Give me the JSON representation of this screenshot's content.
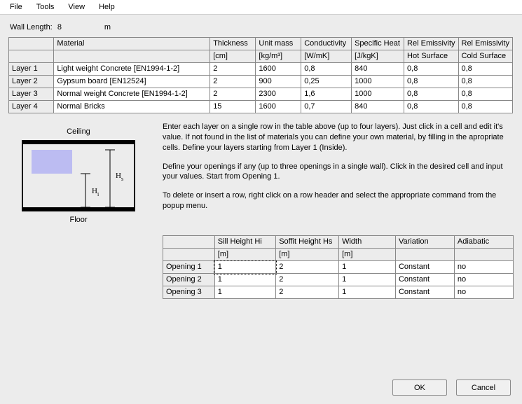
{
  "menu": {
    "items": [
      "File",
      "Tools",
      "View",
      "Help"
    ]
  },
  "wall_length": {
    "label": "Wall Length:",
    "value": "8",
    "unit": "m"
  },
  "layers_table": {
    "headers1": [
      "",
      "Material",
      "Thickness",
      "Unit mass",
      "Conductivity",
      "Specific Heat",
      "Rel Emissivity",
      "Rel Emissivity"
    ],
    "headers2": [
      "",
      "",
      "[cm]",
      "[kg/m³]",
      "[W/mK]",
      "[J/kgK]",
      "Hot Surface",
      "Cold Surface"
    ],
    "rows": [
      {
        "name": "Layer 1",
        "material": "Light weight Concrete [EN1994-1-2]",
        "thickness": "2",
        "unitmass": "1600",
        "conductivity": "0,8",
        "specheat": "840",
        "emis_hot": "0,8",
        "emis_cold": "0,8"
      },
      {
        "name": "Layer 2",
        "material": "Gypsum board [EN12524]",
        "thickness": "2",
        "unitmass": "900",
        "conductivity": "0,25",
        "specheat": "1000",
        "emis_hot": "0,8",
        "emis_cold": "0,8"
      },
      {
        "name": "Layer 3",
        "material": "Normal weight Concrete [EN1994-1-2]",
        "thickness": "2",
        "unitmass": "2300",
        "conductivity": "1,6",
        "specheat": "1000",
        "emis_hot": "0,8",
        "emis_cold": "0,8"
      },
      {
        "name": "Layer 4",
        "material": "Normal Bricks",
        "thickness": "15",
        "unitmass": "1600",
        "conductivity": "0,7",
        "specheat": "840",
        "emis_hot": "0,8",
        "emis_cold": "0,8"
      }
    ]
  },
  "diagram": {
    "top_label": "Ceiling",
    "bottom_label": "Floor",
    "h_s": "H",
    "h_s_sub": "s",
    "h_i": "H",
    "h_i_sub": "i"
  },
  "instructions": {
    "p1": "Enter each layer on a single row in the table above (up to four layers). Just click in a cell and edit it's value. If not found in the list of materials you can define your own material, by filling in the apropriate cells. Define your layers starting from Layer 1 (Inside).",
    "p2": "Define your openings if any (up to three openings in a single wall). Click in the desired cell and input your values. Start from Opening 1.",
    "p3": "To delete or insert a row, right click on a row header and select the appropriate command from the popup menu."
  },
  "openings_table": {
    "headers1": [
      "",
      "Sill Height Hi",
      "Soffit Height Hs",
      "Width",
      "Variation",
      "Adiabatic"
    ],
    "headers2": [
      "",
      "[m]",
      "[m]",
      "[m]",
      "",
      ""
    ],
    "rows": [
      {
        "name": "Opening 1",
        "sill": "1",
        "soffit": "2",
        "width": "1",
        "variation": "Constant",
        "adiabatic": "no"
      },
      {
        "name": "Opening 2",
        "sill": "1",
        "soffit": "2",
        "width": "1",
        "variation": "Constant",
        "adiabatic": "no"
      },
      {
        "name": "Opening 3",
        "sill": "1",
        "soffit": "2",
        "width": "1",
        "variation": "Constant",
        "adiabatic": "no"
      }
    ]
  },
  "buttons": {
    "ok": "OK",
    "cancel": "Cancel"
  }
}
